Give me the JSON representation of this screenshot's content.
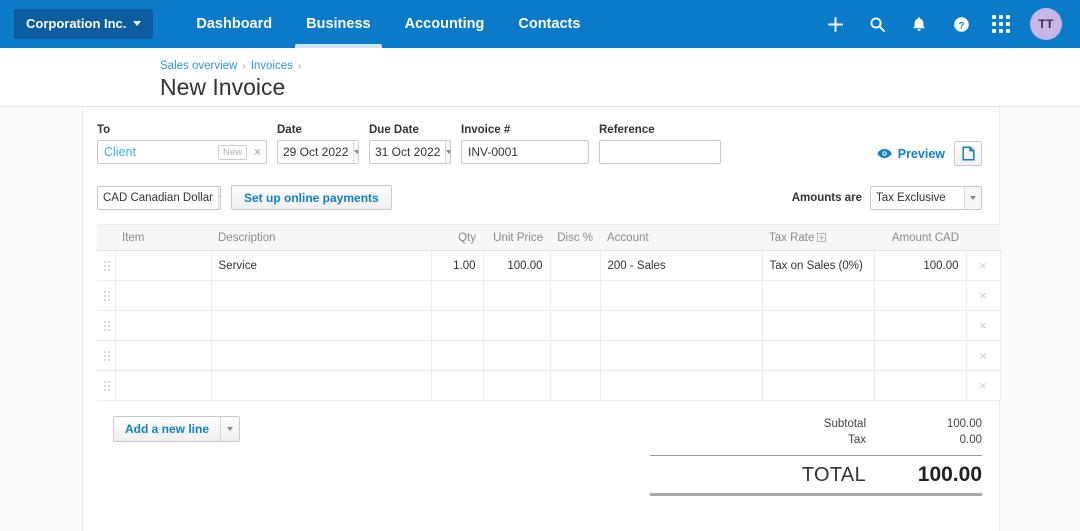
{
  "navbar": {
    "org_button": {
      "label": "Corporation Inc.",
      "icon": "chevron-down-icon"
    },
    "links": [
      {
        "label": "Dashboard",
        "active": false
      },
      {
        "label": "Business",
        "active": true
      },
      {
        "label": "Accounting",
        "active": false
      },
      {
        "label": "Contacts",
        "active": false
      }
    ],
    "actions": [
      {
        "name": "plus-icon",
        "label": "+"
      },
      {
        "name": "search-icon",
        "label": ""
      },
      {
        "name": "bell-icon",
        "label": ""
      },
      {
        "name": "help-icon",
        "label": "?"
      },
      {
        "name": "apps-grid-icon",
        "label": ""
      }
    ],
    "avatar_initials": "TT",
    "colors": {
      "bar": "#0a7ac9",
      "org_button": "#0c5d9f",
      "avatar": "#c9b6e8",
      "active_underline": "#cfe6f7"
    }
  },
  "header": {
    "breadcrumb": [
      {
        "label": "Sales overview",
        "link": true
      },
      {
        "label": "Invoices",
        "link": true
      }
    ],
    "separator": "›",
    "title": "New Invoice"
  },
  "form": {
    "to": {
      "label": "To",
      "value": "Client",
      "badge": "New",
      "clear_icon": "×"
    },
    "date": {
      "label": "Date",
      "value": "29 Oct 2022"
    },
    "due_date": {
      "label": "Due Date",
      "value": "31 Oct 2022"
    },
    "invoice_number": {
      "label": "Invoice #",
      "value": "INV-0001"
    },
    "reference": {
      "label": "Reference",
      "value": "",
      "placeholder": ""
    },
    "preview": {
      "label": "Preview",
      "icon": "eye-icon"
    },
    "attachment_button": {
      "icon": "file-attachment-icon"
    },
    "currency": {
      "value": "CAD Canadian Dollar"
    },
    "online_payments_button": "Set up online payments",
    "amounts_are": {
      "label": "Amounts are",
      "value": "Tax Exclusive"
    }
  },
  "table": {
    "columns": [
      {
        "key": "handle",
        "label": "",
        "align": "left"
      },
      {
        "key": "item",
        "label": "Item",
        "align": "left"
      },
      {
        "key": "description",
        "label": "Description",
        "align": "left"
      },
      {
        "key": "qty",
        "label": "Qty",
        "align": "right"
      },
      {
        "key": "unit_price",
        "label": "Unit Price",
        "align": "right"
      },
      {
        "key": "disc",
        "label": "Disc %",
        "align": "right"
      },
      {
        "key": "account",
        "label": "Account",
        "align": "left"
      },
      {
        "key": "tax_rate",
        "label": "Tax Rate",
        "align": "left",
        "icon": "add-tax-rate-icon"
      },
      {
        "key": "amount",
        "label": "Amount CAD",
        "align": "right"
      },
      {
        "key": "delete",
        "label": "",
        "align": "center"
      }
    ],
    "rows": [
      {
        "item": "",
        "description": "Service",
        "qty": "1.00",
        "unit_price": "100.00",
        "disc": "",
        "account": "200 - Sales",
        "tax_rate": "Tax on Sales (0%)",
        "amount": "100.00"
      },
      {
        "item": "",
        "description": "",
        "qty": "",
        "unit_price": "",
        "disc": "",
        "account": "",
        "tax_rate": "",
        "amount": ""
      },
      {
        "item": "",
        "description": "",
        "qty": "",
        "unit_price": "",
        "disc": "",
        "account": "",
        "tax_rate": "",
        "amount": ""
      },
      {
        "item": "",
        "description": "",
        "qty": "",
        "unit_price": "",
        "disc": "",
        "account": "",
        "tax_rate": "",
        "amount": ""
      },
      {
        "item": "",
        "description": "",
        "qty": "",
        "unit_price": "",
        "disc": "",
        "account": "",
        "tax_rate": "",
        "amount": ""
      }
    ],
    "delete_icon": "×"
  },
  "footer": {
    "add_line_button": "Add a new line",
    "subtotal": {
      "label": "Subtotal",
      "value": "100.00"
    },
    "tax": {
      "label": "Tax",
      "value": "0.00"
    },
    "total": {
      "label": "TOTAL",
      "value": "100.00"
    }
  }
}
